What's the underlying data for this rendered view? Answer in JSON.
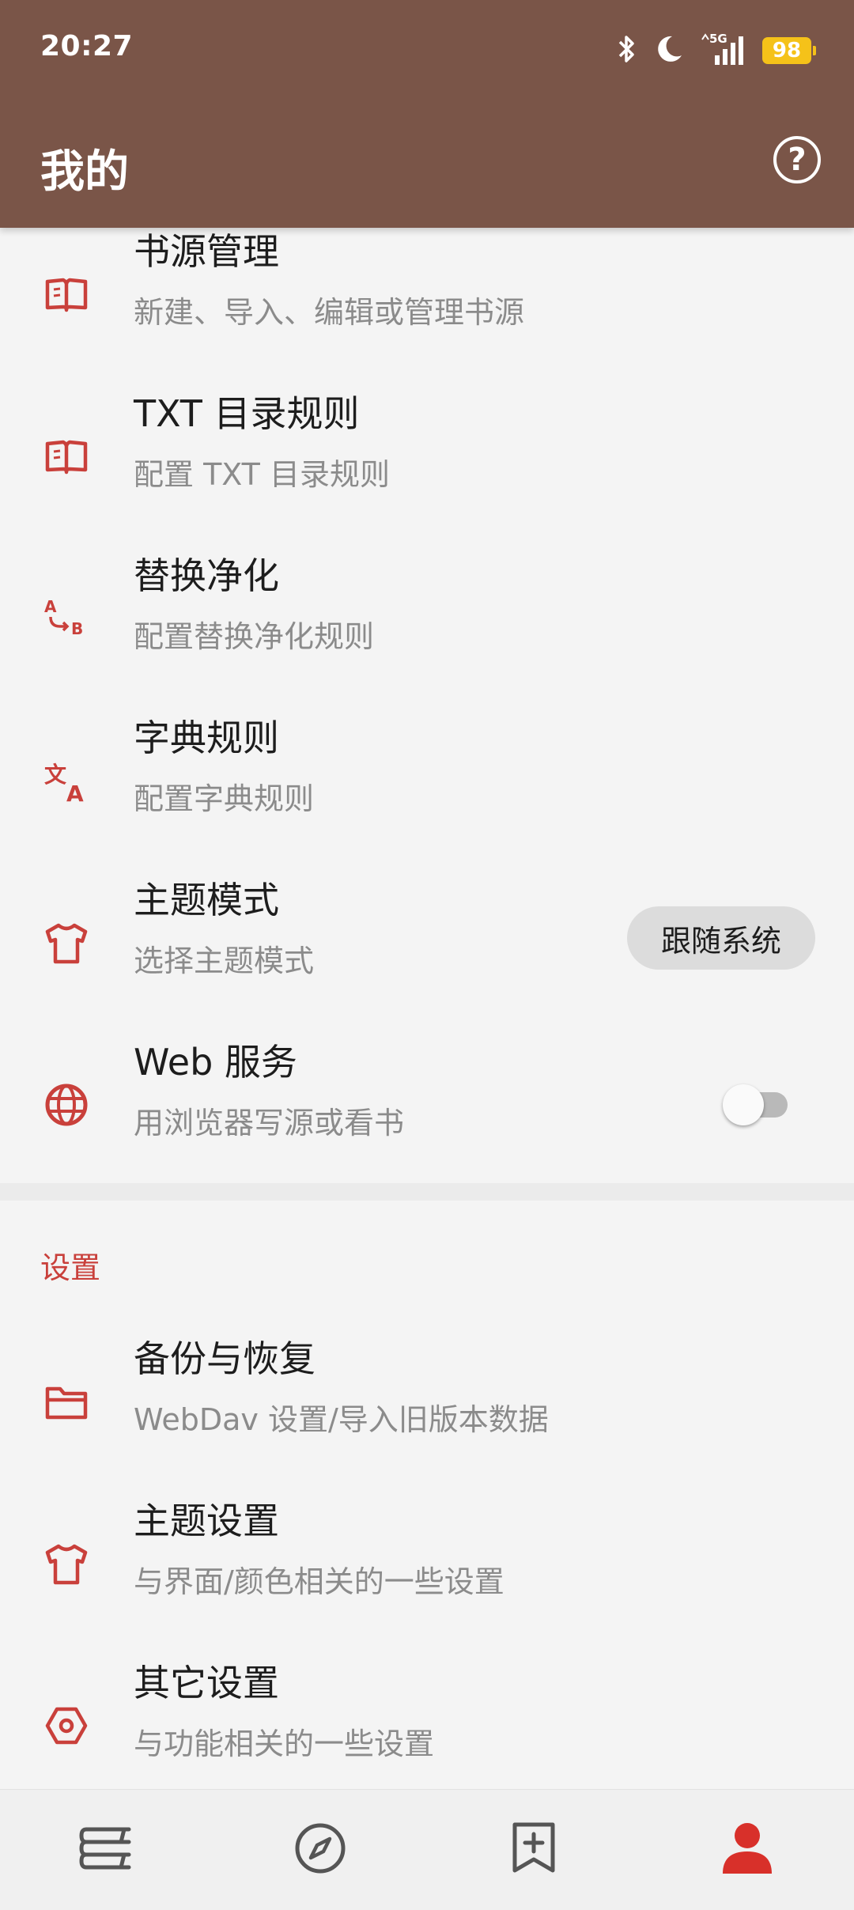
{
  "status_bar": {
    "time": "20:27",
    "network": "5G",
    "battery": "98"
  },
  "header": {
    "title": "我的",
    "help_icon": "help-circle-icon"
  },
  "colors": {
    "header_bg": "#7a5548",
    "accent": "#c9403b",
    "background": "#f4f4f4"
  },
  "items": [
    {
      "title": "书源管理",
      "subtitle": "新建、导入、编辑或管理书源",
      "icon": "book-open-icon"
    },
    {
      "title": "TXT 目录规则",
      "subtitle": "配置 TXT 目录规则",
      "icon": "book-open-icon"
    },
    {
      "title": "替换净化",
      "subtitle": "配置替换净化规则",
      "icon": "replace-a-b-icon"
    },
    {
      "title": "字典规则",
      "subtitle": "配置字典规则",
      "icon": "translate-icon"
    },
    {
      "title": "主题模式",
      "subtitle": "选择主题模式",
      "icon": "tshirt-icon",
      "value": "跟随系统"
    },
    {
      "title": "Web 服务",
      "subtitle": "用浏览器写源或看书",
      "icon": "globe-icon",
      "toggle": false
    }
  ],
  "settings": {
    "section_title": "设置",
    "items": [
      {
        "title": "备份与恢复",
        "subtitle": "WebDav 设置/导入旧版本数据",
        "icon": "folder-icon"
      },
      {
        "title": "主题设置",
        "subtitle": "与界面/颜色相关的一些设置",
        "icon": "tshirt-icon"
      },
      {
        "title": "其它设置",
        "subtitle": "与功能相关的一些设置",
        "icon": "settings-hexagon-icon"
      }
    ]
  },
  "bottom_nav": [
    {
      "icon": "bookshelf-icon",
      "active": false
    },
    {
      "icon": "compass-icon",
      "active": false
    },
    {
      "icon": "bookmark-add-icon",
      "active": false
    },
    {
      "icon": "person-icon",
      "active": true
    }
  ]
}
